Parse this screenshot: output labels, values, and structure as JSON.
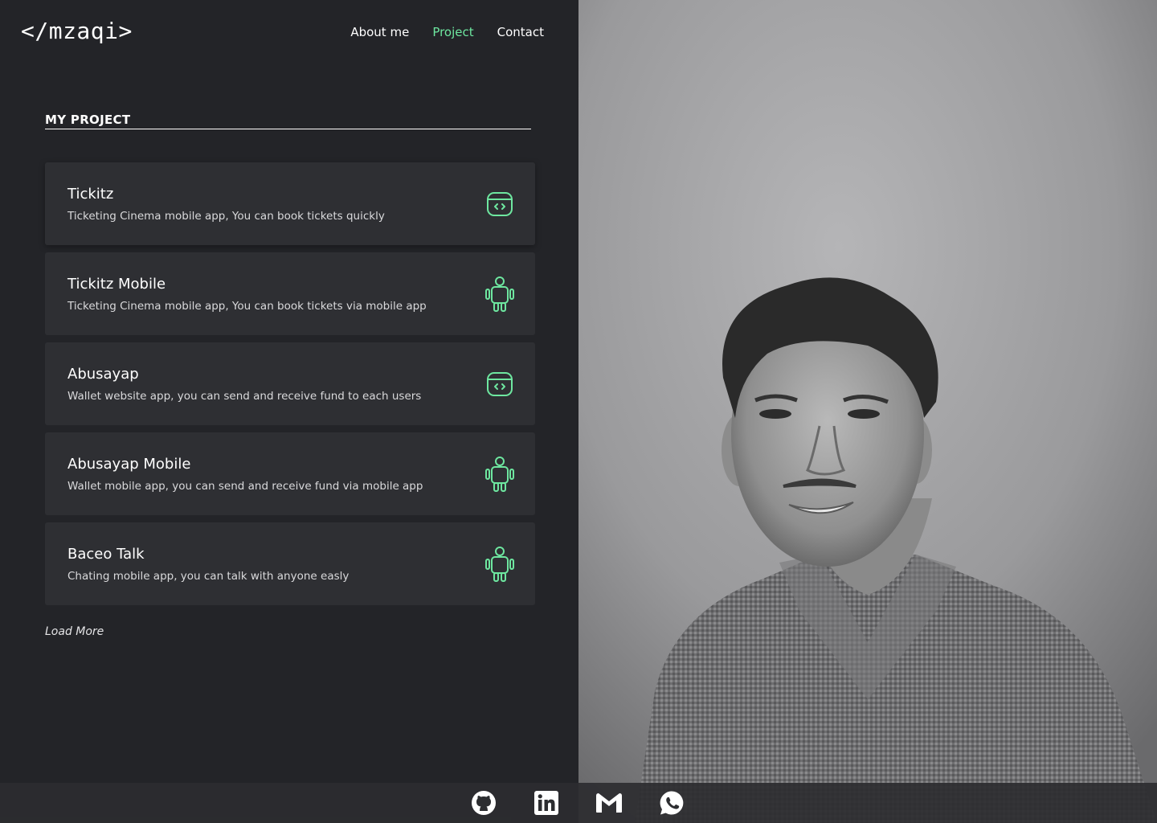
{
  "brand": {
    "logo_text": "</mzaqi>"
  },
  "nav": {
    "items": [
      "About me",
      "Project",
      "Contact"
    ],
    "active": "Project"
  },
  "section": {
    "title": "MY PROJECT"
  },
  "projects": [
    {
      "name": "Tickitz",
      "description": "Ticketing Cinema mobile app, You can book tickets quickly",
      "icon": "web-code-icon"
    },
    {
      "name": "Tickitz Mobile",
      "description": "Ticketing Cinema mobile app, You can book tickets via mobile app",
      "icon": "android-icon"
    },
    {
      "name": "Abusayap",
      "description": "Wallet website app, you can send and receive fund to each users",
      "icon": "web-code-icon"
    },
    {
      "name": "Abusayap Mobile",
      "description": "Wallet mobile app, you can send and receive fund via mobile app",
      "icon": "android-icon"
    },
    {
      "name": "Baceo Talk",
      "description": "Chating mobile app, you can talk with anyone easly",
      "icon": "android-icon"
    }
  ],
  "load_more": "Load More",
  "socials": [
    "github-icon",
    "linkedin-icon",
    "gmail-icon",
    "whatsapp-icon"
  ],
  "colors": {
    "background": "#232428",
    "card": "#2e2f33",
    "accent": "#6ee7a0",
    "text": "#ffffff"
  }
}
